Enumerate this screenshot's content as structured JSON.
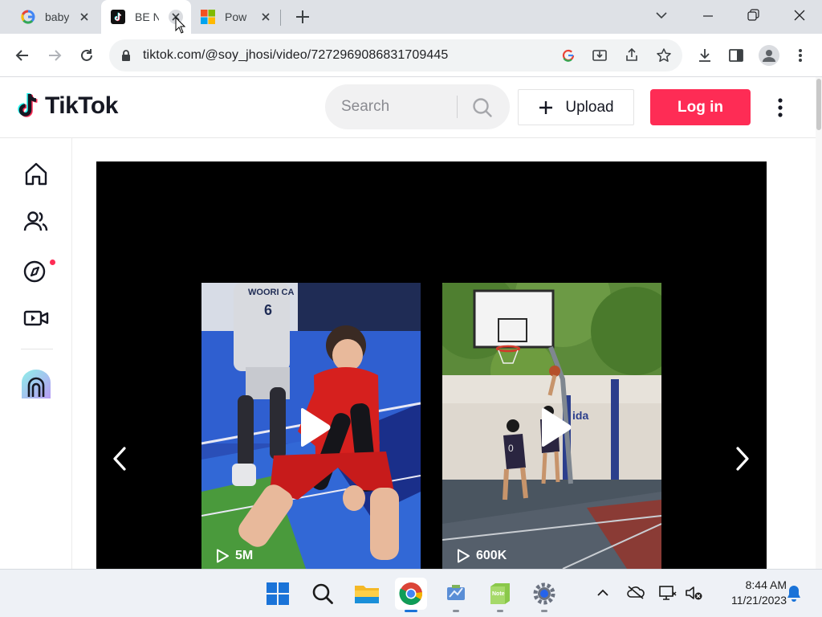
{
  "browser": {
    "tabs": [
      {
        "title": "baby",
        "icon": "google-icon",
        "active": false
      },
      {
        "title": "BE N",
        "icon": "tiktok-icon",
        "active": true
      },
      {
        "title": "Pow",
        "icon": "microsoft-icon",
        "active": false
      }
    ],
    "url": "tiktok.com/@soy_jhosi/video/7272969086831709445"
  },
  "tiktok": {
    "logo_text": "TikTok",
    "search_placeholder": "Search",
    "upload_label": "Upload",
    "login_label": "Log in",
    "brand_color": "#fe2c55",
    "sidebar": [
      "home-icon",
      "following-icon",
      "explore-icon",
      "live-icon",
      "live-studio-icon"
    ],
    "videos": [
      {
        "views": "5M",
        "subject": "volleyball player"
      },
      {
        "views": "600K",
        "subject": "basketball players"
      }
    ]
  },
  "taskbar": {
    "time": "8:44 AM",
    "date": "11/21/2023"
  }
}
